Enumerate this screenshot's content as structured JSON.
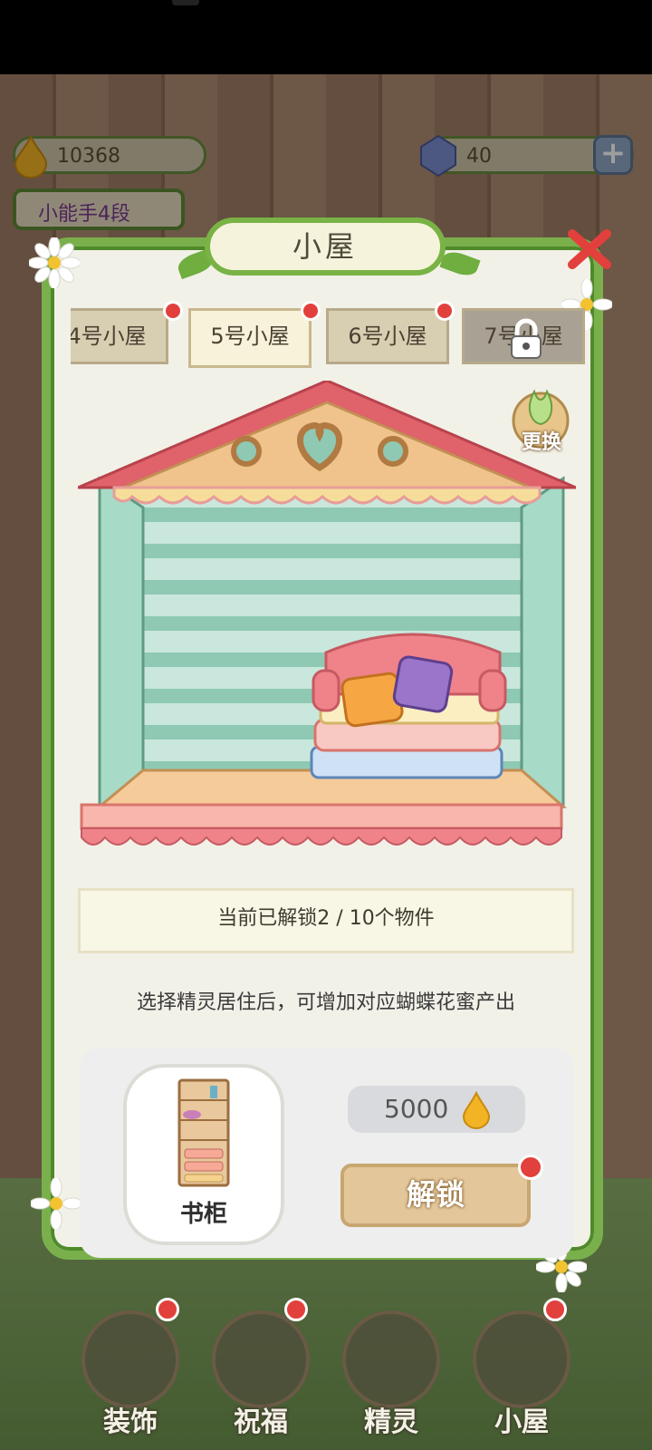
{
  "status_bar": {},
  "resources": {
    "gold": {
      "value": "10368",
      "icon": "honey-drop-icon"
    },
    "gem": {
      "value": "40",
      "icon": "gem-icon",
      "add_label": "+"
    }
  },
  "level": {
    "text": "小能手4段"
  },
  "modal": {
    "title": "小屋",
    "tabs": [
      {
        "label": "4号小屋",
        "badge": true
      },
      {
        "label": "5号小屋",
        "badge": true,
        "active": true
      },
      {
        "label": "6号小屋",
        "badge": true
      },
      {
        "label": "7号小屋",
        "locked": true
      }
    ],
    "swap_label": "更换",
    "unlock_progress": "当前已解锁2 / 10个物件",
    "hint": "选择精灵居住后，可增加对应蝴蝶花蜜产出",
    "item": {
      "name": "书柜",
      "price": "5000",
      "price_icon": "honey-drop-icon"
    },
    "unlock_button": "解锁"
  },
  "bottom_nav": [
    {
      "label": "装饰",
      "badge": true
    },
    {
      "label": "祝福",
      "badge": true
    },
    {
      "label": "精灵",
      "badge": false
    },
    {
      "label": "小屋",
      "badge": true
    }
  ],
  "colors": {
    "accent_green": "#7ab04b",
    "badge_red": "#e2403c",
    "roof_red": "#e0626a",
    "wall_teal": "#8fc9b3"
  }
}
